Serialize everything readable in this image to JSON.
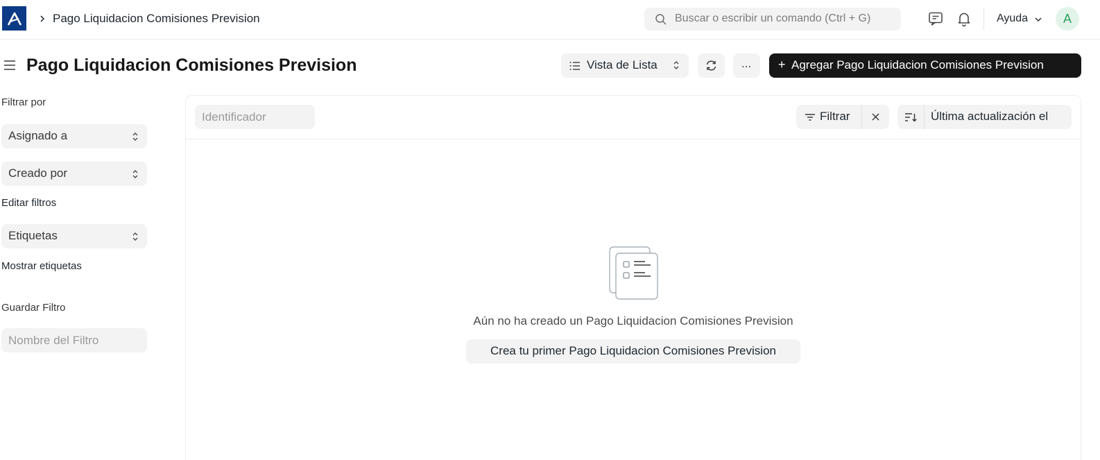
{
  "navbar": {
    "breadcrumb": "Pago Liquidacion Comisiones Prevision",
    "search_placeholder": "Buscar o escribir un comando (Ctrl + G)",
    "help_label": "Ayuda",
    "avatar_initial": "A"
  },
  "page": {
    "title": "Pago Liquidacion Comisiones Prevision",
    "view_label": "Vista de Lista",
    "more_label": "...",
    "add_button_label": "Agregar Pago Liquidacion Comisiones Prevision",
    "add_button_plus": "+"
  },
  "sidebar": {
    "filter_by_label": "Filtrar por",
    "assigned_to": "Asignado a",
    "created_by": "Creado por",
    "edit_filters": "Editar filtros",
    "tags": "Etiquetas",
    "show_tags": "Mostrar etiquetas",
    "save_filter_label": "Guardar Filtro",
    "filter_name_placeholder": "Nombre del Filtro"
  },
  "list": {
    "id_placeholder": "Identificador",
    "filter_label": "Filtrar",
    "sort_label": "Última actualización el",
    "empty_message": "Aún no ha creado un Pago Liquidacion Comisiones Prevision",
    "create_first_label": "Crea tu primer Pago Liquidacion Comisiones Prevision"
  },
  "colors": {
    "brand": "#0c3a86",
    "primary_button": "#171717",
    "control_bg": "#f3f3f3"
  }
}
